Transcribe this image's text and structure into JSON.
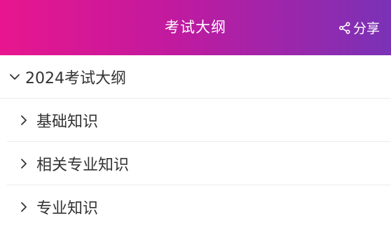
{
  "header": {
    "title": "考试大纲",
    "share_label": "分享"
  },
  "outline": {
    "root": {
      "label": "2024考试大纲",
      "expanded": true
    },
    "children": [
      {
        "label": "基础知识"
      },
      {
        "label": "相关专业知识"
      },
      {
        "label": "专业知识"
      }
    ]
  },
  "colors": {
    "header_gradient_start": "#e8168e",
    "header_gradient_end": "#7a32b6",
    "text": "#333333",
    "divider": "#ececec"
  }
}
